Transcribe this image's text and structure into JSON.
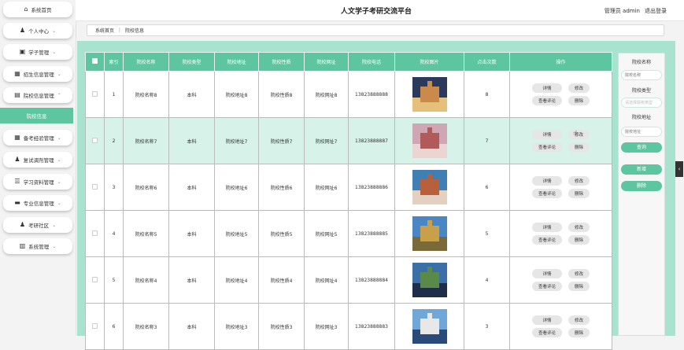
{
  "topbar": {
    "title": "人文学子考研交流平台",
    "user": "管理员 admin",
    "logout": "退出登录"
  },
  "sidebar": {
    "items": [
      {
        "icon": "home-icon",
        "glyph": "⌂",
        "label": "系统首页",
        "chevron": ""
      },
      {
        "icon": "person-icon",
        "glyph": "♟",
        "label": "个人中心",
        "chevron": "⌄"
      },
      {
        "icon": "id-card-icon",
        "glyph": "▣",
        "label": "学子管理",
        "chevron": "⌄"
      },
      {
        "icon": "grid-icon",
        "glyph": "▦",
        "label": "招生信息管理",
        "chevron": "⌄"
      },
      {
        "icon": "school-icon",
        "glyph": "▤",
        "label": "院校信息管理",
        "chevron": "⌃"
      },
      {
        "icon": "grid-icon",
        "glyph": "▦",
        "label": "备考经验管理",
        "chevron": "⌄"
      },
      {
        "icon": "person-icon",
        "glyph": "♟",
        "label": "复试调剂管理",
        "chevron": "⌄"
      },
      {
        "icon": "list-icon",
        "glyph": "☰",
        "label": "学习资料管理",
        "chevron": "⌄"
      },
      {
        "icon": "chat-icon",
        "glyph": "▬",
        "label": "专业信息管理",
        "chevron": "⌄"
      },
      {
        "icon": "person-icon",
        "glyph": "♟",
        "label": "考研社区",
        "chevron": "⌄"
      },
      {
        "icon": "bar-chart-icon",
        "glyph": "▥",
        "label": "系统管理",
        "chevron": "⌄"
      }
    ],
    "sub_item": "院校信息"
  },
  "breadcrumb": {
    "home": "系统首页",
    "sep": "⋮",
    "current": "院校信息"
  },
  "table": {
    "headers": [
      "",
      "索引",
      "院校名称",
      "院校类型",
      "院校地址",
      "院校性质",
      "院校网址",
      "院校电话",
      "院校图片",
      "点击次数",
      "操作"
    ],
    "rows": [
      {
        "idx": "1",
        "name": "院校名称8",
        "type": "本科",
        "addr": "院校地址8",
        "nature": "院校性质8",
        "site": "院校网址8",
        "phone": "13823888888",
        "clicks": "8"
      },
      {
        "idx": "2",
        "name": "院校名称7",
        "type": "本科",
        "addr": "院校地址7",
        "nature": "院校性质7",
        "site": "院校网址7",
        "phone": "13823888887",
        "clicks": "7"
      },
      {
        "idx": "3",
        "name": "院校名称6",
        "type": "本科",
        "addr": "院校地址6",
        "nature": "院校性质6",
        "site": "院校网址6",
        "phone": "13823888886",
        "clicks": "6"
      },
      {
        "idx": "4",
        "name": "院校名称5",
        "type": "本科",
        "addr": "院校地址5",
        "nature": "院校性质5",
        "site": "院校网址5",
        "phone": "13823888885",
        "clicks": "5"
      },
      {
        "idx": "5",
        "name": "院校名称4",
        "type": "本科",
        "addr": "院校地址4",
        "nature": "院校性质4",
        "site": "院校网址4",
        "phone": "13823888884",
        "clicks": "4"
      },
      {
        "idx": "6",
        "name": "院校名称3",
        "type": "本科",
        "addr": "院校地址3",
        "nature": "院校性质3",
        "site": "院校网址3",
        "phone": "13823888883",
        "clicks": "3"
      }
    ],
    "ops": {
      "detail": "详情",
      "edit": "修改",
      "comments": "查看评论",
      "delete": "删除"
    }
  },
  "search_panel": {
    "name_label": "院校名称",
    "name_placeholder": "院校名称",
    "type_label": "院校类型",
    "type_placeholder": "请选择院校类型",
    "addr_label": "院校地址",
    "addr_placeholder": "院校地址",
    "search_btn": "查询",
    "add_btn": "新增",
    "delete_btn": "删除"
  },
  "colors": {
    "accent": "#5ec5a1",
    "panel": "#a8e3cf",
    "selected_row": "#d7f2e8"
  }
}
